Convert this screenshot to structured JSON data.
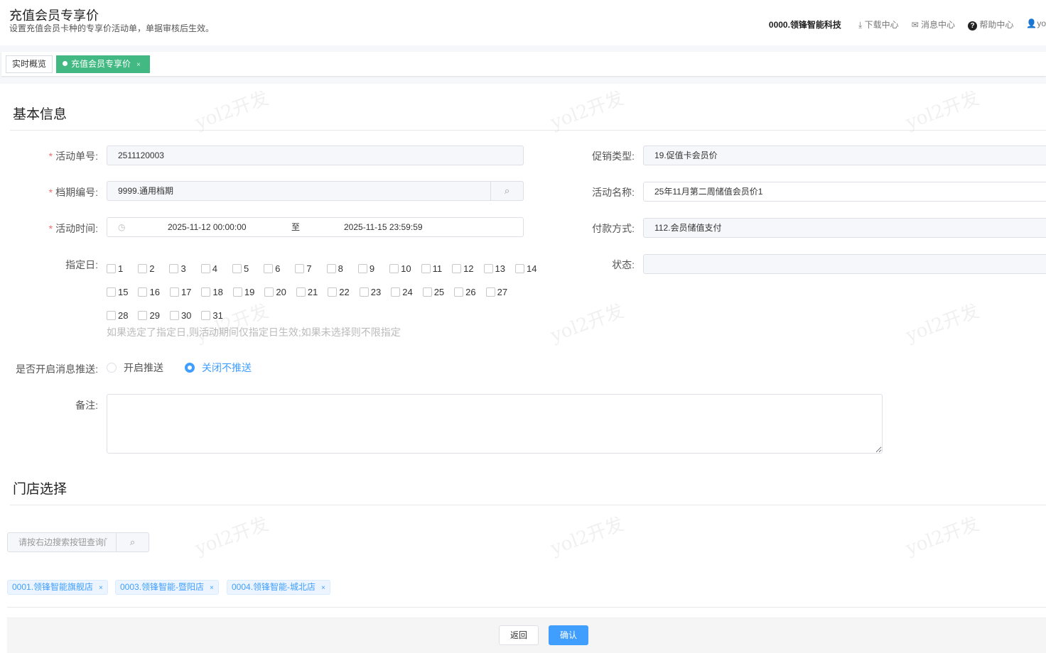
{
  "header": {
    "title": "充值会员专享价",
    "subtitle": "设置充值会员卡种的专享价活动单，单据审核后生效。",
    "company": "0000.领锋智能科技",
    "download": "下载中心",
    "messages": "消息中心",
    "help": "帮助中心",
    "user": "yo"
  },
  "tabs": [
    {
      "label": "实时概览"
    },
    {
      "label": "充值会员专享价",
      "close": "×"
    }
  ],
  "sections": {
    "basic": "基本信息",
    "store": "门店选择"
  },
  "form": {
    "activity_no": {
      "label": "活动单号:",
      "value": "2511120003"
    },
    "period_no": {
      "label": "档期编号:",
      "value": "9999.通用档期"
    },
    "activity_time": {
      "label": "活动时间:",
      "start": "2025-11-12 00:00:00",
      "sep": "至",
      "end": "2025-11-15 23:59:59"
    },
    "promo_type": {
      "label": "促销类型:",
      "value": "19.促值卡会员价"
    },
    "activity_name": {
      "label": "活动名称:",
      "value": "25年11月第二周储值会员价1"
    },
    "payment": {
      "label": "付款方式:",
      "value": "112.会员储值支付"
    },
    "status": {
      "label": "状态:",
      "value": ""
    },
    "days": {
      "label": "指定日:",
      "rows": [
        [
          "1",
          "2",
          "3",
          "4",
          "5",
          "6",
          "7",
          "8",
          "9",
          "10",
          "11",
          "12",
          "13",
          "14"
        ],
        [
          "15",
          "16",
          "17",
          "18",
          "19",
          "20",
          "21",
          "22",
          "23",
          "24",
          "25",
          "26",
          "27"
        ],
        [
          "28",
          "29",
          "30",
          "31"
        ]
      ],
      "hint": "如果选定了指定日,则活动期间仅指定日生效;如果未选择则不限指定"
    },
    "push": {
      "label": "是否开启消息推送:",
      "on": "开启推送",
      "off": "关闭不推送",
      "selected": "off"
    },
    "remark": {
      "label": "备注:",
      "value": ""
    }
  },
  "store": {
    "search_placeholder": "请按右边搜索按钮查询门店",
    "tags": [
      "0001.领锋智能旗舰店",
      "0003.领锋智能-暨阳店",
      "0004.领锋智能-城北店"
    ],
    "tag_close": "×"
  },
  "footer": {
    "back": "返回",
    "confirm": "确认"
  },
  "watermark": "yol2开发",
  "colors": {
    "accent": "#409eff",
    "tab_active": "#42b983",
    "required": "#f56c6c"
  }
}
